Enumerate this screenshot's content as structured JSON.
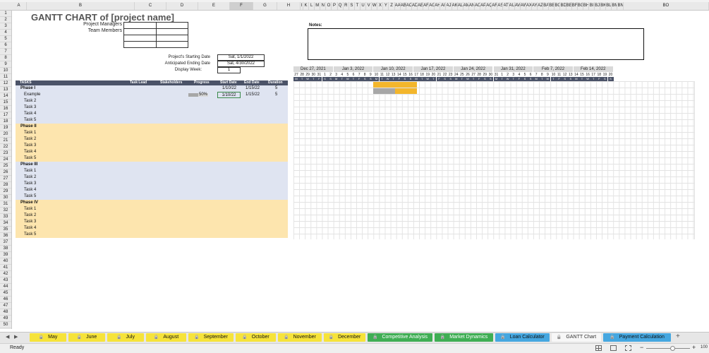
{
  "columns": [
    "A",
    "B",
    "C",
    "D",
    "E",
    "F",
    "G",
    "H",
    "I",
    "K",
    "L",
    "M",
    "N",
    "O",
    "P",
    "Q",
    "R",
    "S",
    "T",
    "U",
    "V",
    "W",
    "X",
    "Y",
    "Z",
    "AA",
    "AB",
    "AC",
    "AD",
    "AE",
    "AF",
    "AG",
    "AH",
    "AI",
    "AJ",
    "AK",
    "AL",
    "AM",
    "AN",
    "AO",
    "AP",
    "AQ",
    "AR",
    "AS",
    "AT",
    "AU",
    "AV",
    "AW",
    "AX",
    "AY",
    "AZ",
    "BA",
    "BB",
    "BC",
    "BD",
    "BE",
    "BF",
    "BG",
    "BH",
    "BI",
    "BJ",
    "BK",
    "BL",
    "BM",
    "BN",
    "BO"
  ],
  "selected_column": "F",
  "row_numbers": [
    "1",
    "2",
    "3",
    "4",
    "5",
    "6",
    "7",
    "8",
    "9",
    "10",
    "11",
    "12",
    "13",
    "14",
    "15",
    "16",
    "17",
    "18",
    "19",
    "20",
    "21",
    "22",
    "23",
    "24",
    "25",
    "26",
    "27",
    "28",
    "29",
    "30",
    "31",
    "32",
    "33",
    "34",
    "35",
    "36",
    "37",
    "38",
    "39",
    "40",
    "41",
    "42",
    "43",
    "44",
    "45",
    "46",
    "47",
    "48",
    "49",
    "50"
  ],
  "title": "GANTT CHART of [project name]",
  "labels": {
    "project_managers": "Project Managers",
    "team_members": "Team Members",
    "starting_date": "Project's Starting Date",
    "ending_date": "Anticipated Ending Date",
    "display_week": "Display Week:",
    "notes": "Notes:"
  },
  "values": {
    "starting_date": "Sat, 1/1/2022",
    "ending_date": "Sat, 4/30/2022",
    "display_week": "1"
  },
  "task_header": {
    "tasks": "TASKS",
    "task_lead": "Task Lead",
    "stakeholders": "Stakeholders",
    "progress": "Progress",
    "start_date": "Start Date",
    "end_date": "End Date",
    "duration": "Duration"
  },
  "phases": [
    {
      "name": "Phase I",
      "start": "1/10/22",
      "end": "1/15/22",
      "duration": "5",
      "tasks": [
        {
          "name": "Example",
          "progress": "50%",
          "progress_fraction": 0.5,
          "start": "1/10/22",
          "end": "1/15/22",
          "duration": "5"
        },
        {
          "name": "Task 2"
        },
        {
          "name": "Task 3"
        },
        {
          "name": "Task 4"
        },
        {
          "name": "Task 5"
        }
      ]
    },
    {
      "name": "Phase II",
      "tasks": [
        {
          "name": "Task 1"
        },
        {
          "name": "Task 2"
        },
        {
          "name": "Task 3"
        },
        {
          "name": "Task 4"
        },
        {
          "name": "Task 5"
        }
      ]
    },
    {
      "name": "Phase III",
      "tasks": [
        {
          "name": "Task 1"
        },
        {
          "name": "Task 2"
        },
        {
          "name": "Task 3"
        },
        {
          "name": "Task 4"
        },
        {
          "name": "Task 5"
        }
      ]
    },
    {
      "name": "Phase IV",
      "tasks": [
        {
          "name": "Task 1"
        },
        {
          "name": "Task 2"
        },
        {
          "name": "Task 3"
        },
        {
          "name": "Task 4"
        },
        {
          "name": "Task 5"
        }
      ]
    }
  ],
  "gantt": {
    "weeks": [
      "Dec 27, 2021",
      "Jan 3, 2022",
      "Jan 10, 2022",
      "Jan 17, 2022",
      "Jan 24, 2022",
      "Jan 31, 2022",
      "Feb 7, 2022",
      "Feb 14, 2022"
    ],
    "day_numbers": [
      "27",
      "28",
      "29",
      "30",
      "31",
      "1",
      "2",
      "3",
      "4",
      "5",
      "6",
      "7",
      "8",
      "9",
      "10",
      "11",
      "12",
      "13",
      "14",
      "15",
      "16",
      "17",
      "18",
      "19",
      "20",
      "21",
      "22",
      "23",
      "24",
      "25",
      "26",
      "27",
      "28",
      "29",
      "30",
      "31",
      "1",
      "2",
      "3",
      "4",
      "5",
      "6",
      "7",
      "8",
      "9",
      "10",
      "11",
      "12",
      "13",
      "14",
      "15",
      "16",
      "17",
      "18",
      "19",
      "20"
    ],
    "day_letters": [
      "M",
      "T",
      "W",
      "T",
      "F",
      "S",
      "S"
    ],
    "bar_start_day_index": 14,
    "bar_length_days": 6
  },
  "colors": {
    "phase_blue": "#dfe4f1",
    "phase_yellow": "#fde5ae",
    "header_dark": "#4b5368",
    "bar_gold": "#f3b62c",
    "bar_progress": "#a7a7a7"
  },
  "sheet_tabs": [
    {
      "label": "May",
      "style": "ytab",
      "icon": "lock-icon"
    },
    {
      "label": "June",
      "style": "ytab",
      "icon": "lock-icon"
    },
    {
      "label": "July",
      "style": "ytab",
      "icon": "lock-icon"
    },
    {
      "label": "August",
      "style": "ytab",
      "icon": "lock-icon"
    },
    {
      "label": "September",
      "style": "ytab",
      "icon": "lock-icon"
    },
    {
      "label": "October",
      "style": "ytab",
      "icon": "lock-icon"
    },
    {
      "label": "November",
      "style": "ytab",
      "icon": "lock-icon"
    },
    {
      "label": "December",
      "style": "ytab",
      "icon": "lock-icon"
    },
    {
      "label": "Competitive Analysis",
      "style": "gtab",
      "icon": "lock-icon"
    },
    {
      "label": "Market Dynamics",
      "style": "gtab",
      "icon": "lock-icon"
    },
    {
      "label": "Loan Calculator",
      "style": "btab",
      "icon": "lock-icon"
    },
    {
      "label": "GANTT Chart",
      "style": "wtab",
      "icon": "lock-icon"
    },
    {
      "label": "Payment Calculation",
      "style": "btab",
      "icon": "lock-icon"
    }
  ],
  "add_sheet": "+",
  "status": {
    "ready": "Ready",
    "zoom_minus": "−",
    "zoom_plus": "+",
    "zoom_level": "100",
    "zoom_fraction": 0.6
  }
}
